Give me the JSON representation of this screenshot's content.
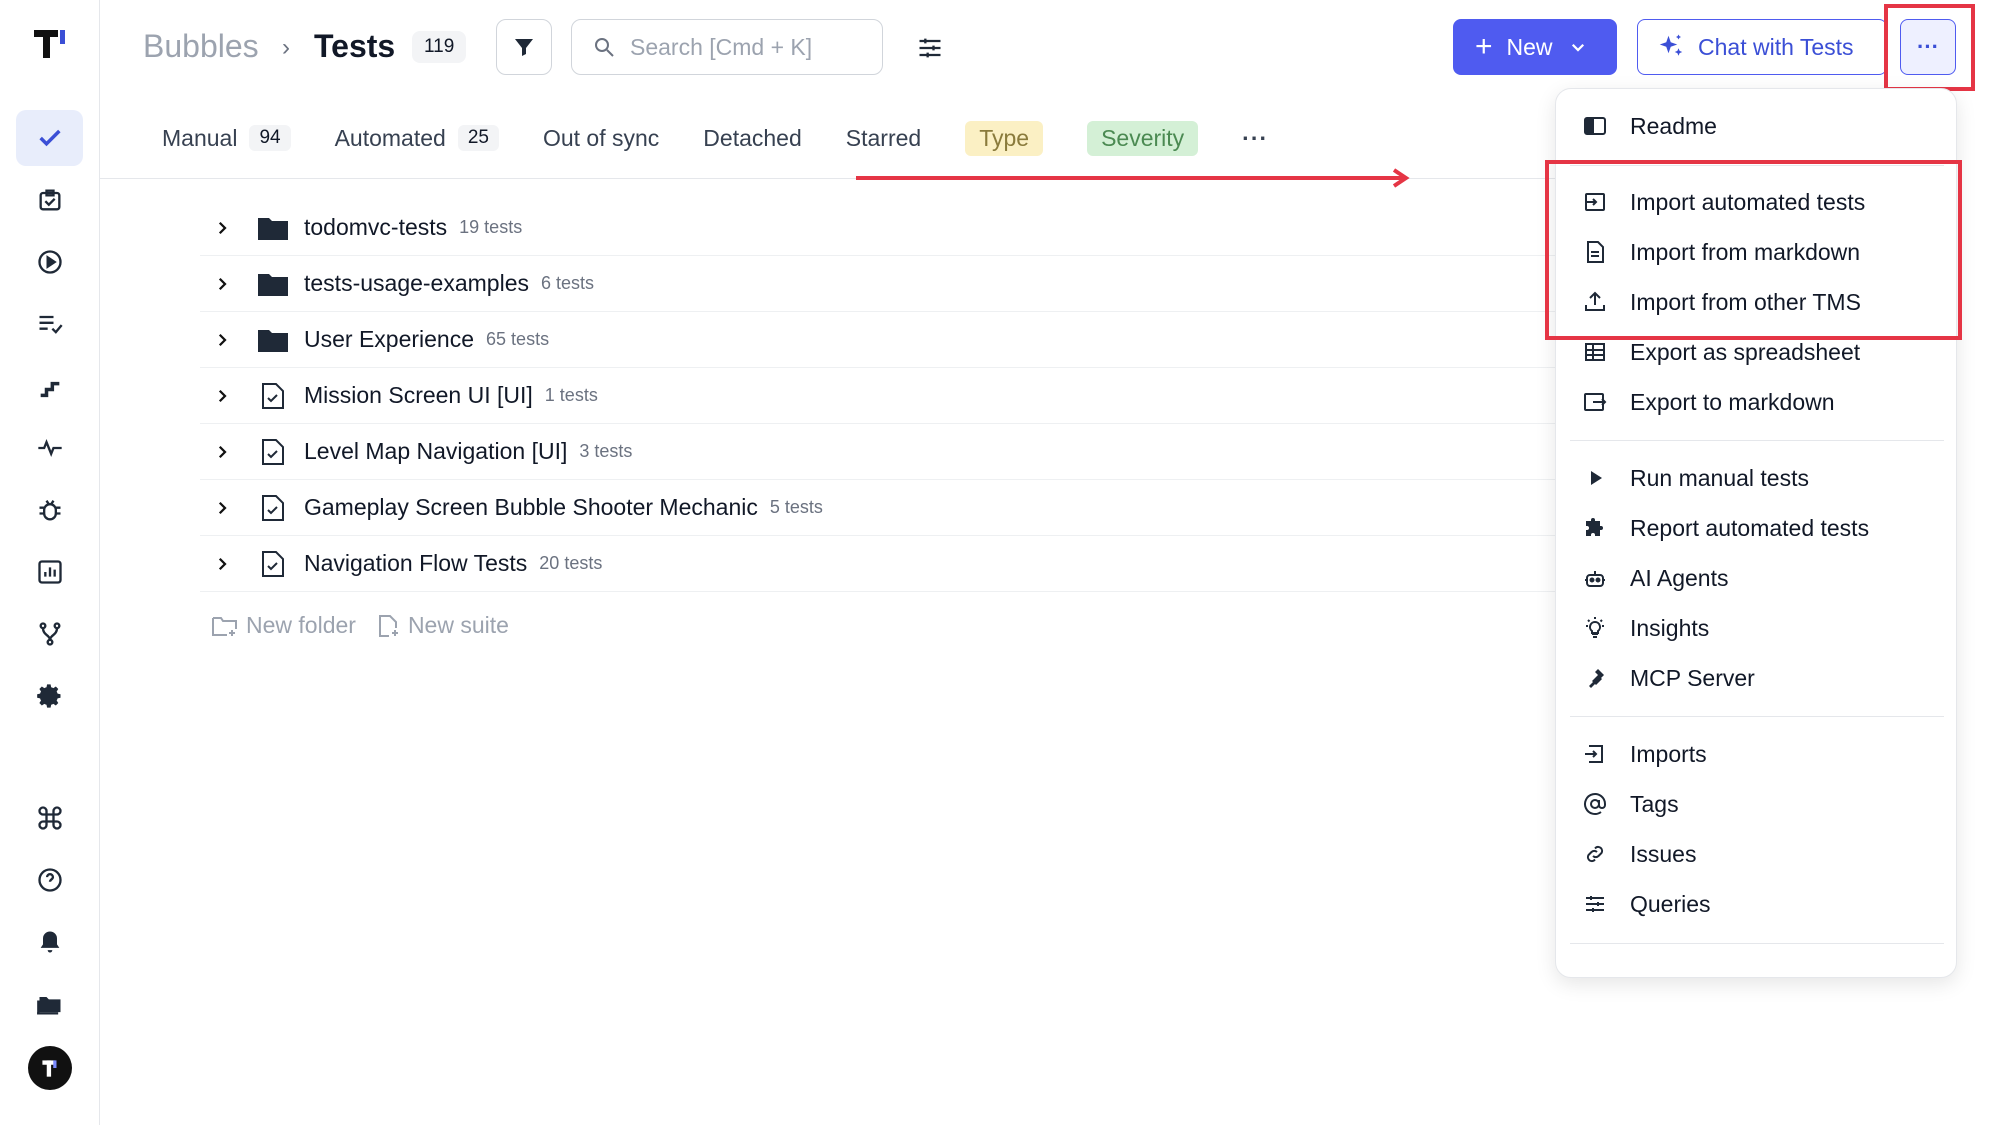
{
  "header": {
    "project": "Bubbles",
    "separator": "›",
    "page_title": "Tests",
    "test_count": "119",
    "search_placeholder": "Search [Cmd + K]",
    "new_label": "New",
    "chat_label": "Chat with Tests",
    "more_label": "···"
  },
  "tabs": [
    {
      "label": "Manual",
      "count": "94"
    },
    {
      "label": "Automated",
      "count": "25"
    },
    {
      "label": "Out of sync"
    },
    {
      "label": "Detached"
    },
    {
      "label": "Starred"
    },
    {
      "label": "Type"
    },
    {
      "label": "Severity"
    },
    {
      "label": "···"
    }
  ],
  "tree": {
    "rows": [
      {
        "type": "folder",
        "name": "todomvc-tests",
        "count": "19 tests"
      },
      {
        "type": "folder",
        "name": "tests-usage-examples",
        "count": "6 tests"
      },
      {
        "type": "folder",
        "name": "User Experience",
        "count": "65 tests"
      },
      {
        "type": "suite",
        "name": "Mission Screen UI [UI]",
        "count": "1 tests"
      },
      {
        "type": "suite",
        "name": "Level Map Navigation [UI]",
        "count": "3 tests"
      },
      {
        "type": "suite",
        "name": "Gameplay Screen Bubble Shooter Mechanic",
        "count": "5 tests"
      },
      {
        "type": "suite",
        "name": "Navigation Flow Tests",
        "count": "20 tests"
      }
    ],
    "new_folder": "New folder",
    "new_suite": "New suite"
  },
  "menu": {
    "items": [
      {
        "label": "Readme",
        "icon": "readme-icon"
      },
      {
        "label": "Import automated tests",
        "icon": "import-icon"
      },
      {
        "label": "Import from markdown",
        "icon": "document-icon"
      },
      {
        "label": "Import from other TMS",
        "icon": "upload-icon"
      },
      {
        "label": "Export as spreadsheet",
        "icon": "table-icon"
      },
      {
        "label": "Export to markdown",
        "icon": "export-icon"
      },
      {
        "label": "Run manual tests",
        "icon": "play-icon"
      },
      {
        "label": "Report automated tests",
        "icon": "puzzle-icon"
      },
      {
        "label": "AI Agents",
        "icon": "robot-icon"
      },
      {
        "label": "Insights",
        "icon": "lightbulb-icon"
      },
      {
        "label": "MCP Server",
        "icon": "plug-icon"
      },
      {
        "label": "Imports",
        "icon": "imports-icon"
      },
      {
        "label": "Tags",
        "icon": "at-icon"
      },
      {
        "label": "Issues",
        "icon": "link-icon"
      },
      {
        "label": "Queries",
        "icon": "sliders-icon"
      }
    ]
  },
  "colors": {
    "accent": "#4f5bf0",
    "highlight": "#e53545",
    "type_pill": "#fbf0c4",
    "severity_pill": "#d4f0d6"
  }
}
